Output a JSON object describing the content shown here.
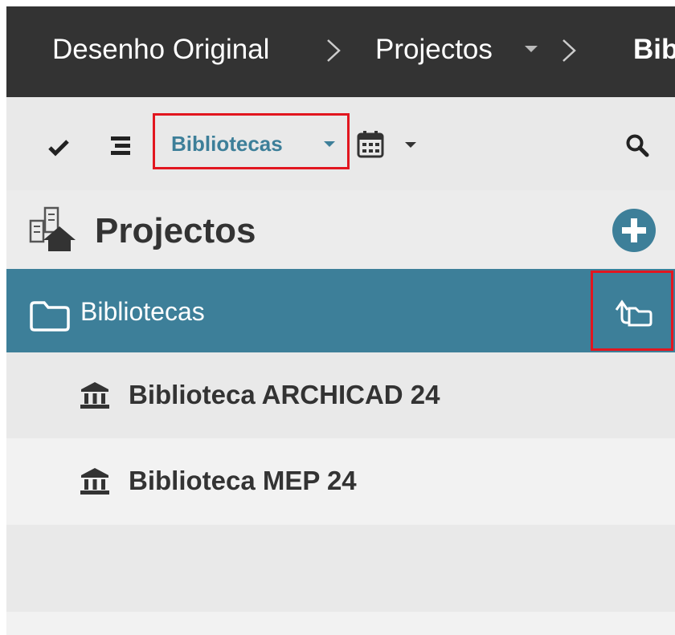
{
  "breadcrumb": {
    "items": [
      "Desenho Original",
      "Projectos",
      "Bib"
    ]
  },
  "toolbar": {
    "library_dropdown_label": "Bibliotecas",
    "icons": [
      "check-icon",
      "list-icon",
      "calendar-icon",
      "search-icon"
    ]
  },
  "panel": {
    "title": "Projectos",
    "add_icon": "plus-circle-icon"
  },
  "folder": {
    "label": "Bibliotecas"
  },
  "libraries": [
    {
      "label": "Biblioteca ARCHICAD 24"
    },
    {
      "label": "Biblioteca MEP 24"
    }
  ],
  "colors": {
    "breadcrumb_bg": "#333333",
    "accent": "#3d7f99",
    "highlight_border": "#e2161f"
  }
}
